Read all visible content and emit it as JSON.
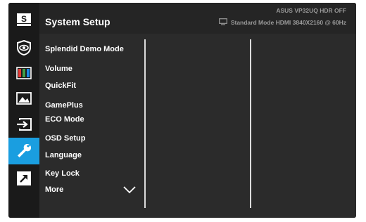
{
  "header": {
    "title": "System Setup",
    "status_line1": "ASUS  VP32UQ  HDR OFF",
    "status_line2": "Standard Mode HDMI 3840X2160 @ 60Hz",
    "display_icon": "monitor-icon"
  },
  "sidebar": {
    "items": [
      {
        "icon": "splendid-s-icon"
      },
      {
        "icon": "eye-care-icon"
      },
      {
        "icon": "color-bars-icon"
      },
      {
        "icon": "image-icon"
      },
      {
        "icon": "input-select-icon"
      },
      {
        "icon": "wrench-icon",
        "active": true
      },
      {
        "icon": "shortcut-arrow-icon"
      }
    ]
  },
  "menu": {
    "items": [
      {
        "label": "Splendid Demo Mode"
      },
      {
        "label": "Volume"
      },
      {
        "label": "QuickFit"
      },
      {
        "label": "GamePlus"
      },
      {
        "label": "ECO Mode"
      },
      {
        "label": "OSD Setup"
      },
      {
        "label": "Language"
      },
      {
        "label": "Key Lock"
      },
      {
        "label": "More"
      }
    ],
    "more_icon": "chevron-down-icon"
  },
  "colors": {
    "active_tab": "#1a9ee0",
    "background": "#2b2b2b",
    "text": "#ffffff",
    "status_text": "#9a9a9a"
  }
}
